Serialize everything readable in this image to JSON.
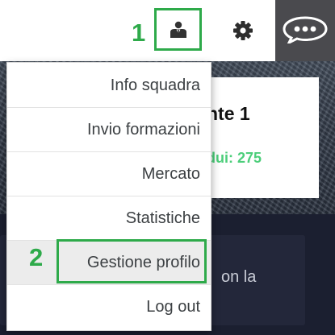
{
  "header": {
    "step_1": "1",
    "user_button_icon": "user-profile-icon",
    "settings_icon": "gear-icon",
    "chat_icon": "chat-bubble-icon"
  },
  "background": {
    "card_title": "nte 1",
    "card_credits": "dui: 275",
    "dark_card_text": "on la"
  },
  "menu": {
    "step_2": "2",
    "items": [
      {
        "label": "Info squadra"
      },
      {
        "label": "Invio formazioni"
      },
      {
        "label": "Mercato"
      },
      {
        "label": "Statistiche"
      },
      {
        "label": "Gestione profilo"
      },
      {
        "label": "Log out"
      }
    ]
  },
  "colors": {
    "accent_green": "#2eaa4a",
    "credits_green": "#4cce7a",
    "chat_panel": "#4a4a4e"
  }
}
